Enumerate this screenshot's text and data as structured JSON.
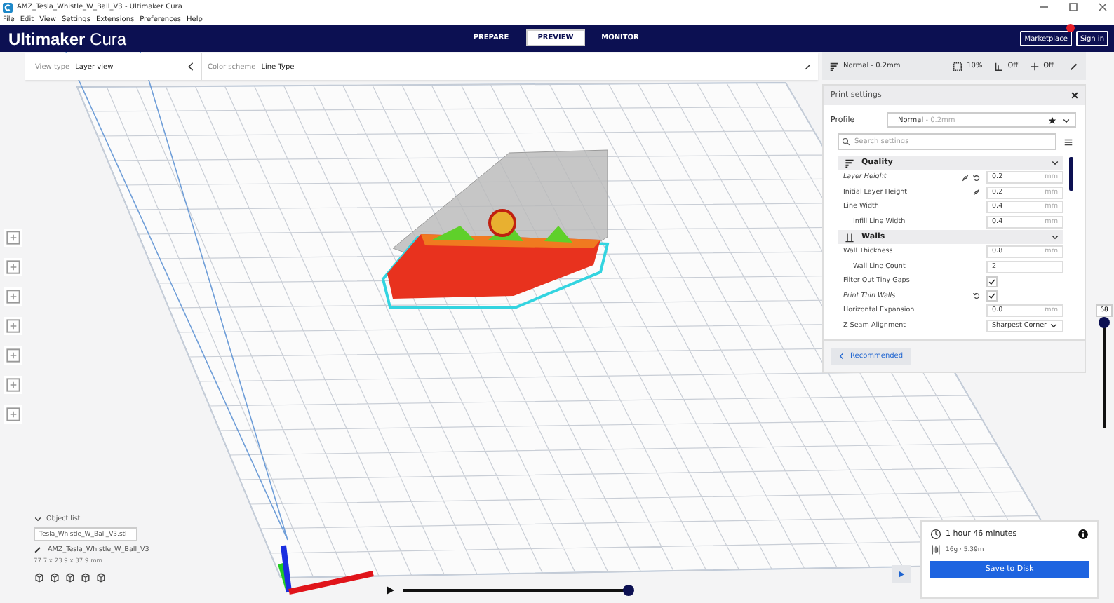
{
  "window": {
    "title": "AMZ_Tesla_Whistle_W_Ball_V3 - Ultimaker Cura"
  },
  "menu": [
    "File",
    "Edit",
    "View",
    "Settings",
    "Extensions",
    "Preferences",
    "Help"
  ],
  "header": {
    "logo_bold": "Ultimaker",
    "logo_light": "Cura",
    "stages": [
      {
        "label": "PREPARE",
        "selected": false
      },
      {
        "label": "PREVIEW",
        "selected": true
      },
      {
        "label": "MONITOR",
        "selected": false
      }
    ],
    "marketplace": "Marketplace",
    "marketplace_notification": true,
    "sign_in": "Sign in"
  },
  "view_bar": {
    "view_type_label": "View type",
    "view_type": "Layer view",
    "color_scheme_label": "Color scheme",
    "color_scheme": "Line Type"
  },
  "print_setup": {
    "profile": "Normal - 0.2mm",
    "infill": "10%",
    "support": "Off",
    "adhesion": "Off"
  },
  "print_settings": {
    "title": "Print settings",
    "profile_label": "Profile",
    "profile_name": "Normal",
    "profile_detail": "- 0.2mm",
    "search_placeholder": "Search settings",
    "categories": [
      {
        "name": "Quality",
        "expanded": true,
        "settings": [
          {
            "label": "Layer Height",
            "kind": "input",
            "value": "0.2",
            "unit": "mm",
            "changed": true,
            "linked": true,
            "resettable": true
          },
          {
            "label": "Initial Layer Height",
            "kind": "input",
            "value": "0.2",
            "unit": "mm",
            "changed": false,
            "linked": true,
            "resettable": false
          },
          {
            "label": "Line Width",
            "kind": "input",
            "value": "0.4",
            "unit": "mm",
            "changed": false,
            "linked": false,
            "resettable": false,
            "children": [
              {
                "label": "Infill Line Width",
                "kind": "input",
                "value": "0.4",
                "unit": "mm",
                "changed": false,
                "linked": false,
                "resettable": false
              }
            ]
          }
        ]
      },
      {
        "name": "Walls",
        "expanded": true,
        "settings": [
          {
            "label": "Wall Thickness",
            "kind": "input",
            "value": "0.8",
            "unit": "mm",
            "changed": false,
            "linked": false,
            "resettable": false,
            "children": [
              {
                "label": "Wall Line Count",
                "kind": "input",
                "value": "2",
                "changed": false,
                "linked": false,
                "resettable": false
              }
            ]
          },
          {
            "label": "Filter Out Tiny Gaps",
            "kind": "checkbox",
            "checked": true,
            "changed": false,
            "linked": false,
            "resettable": false
          },
          {
            "label": "Print Thin Walls",
            "kind": "checkbox",
            "checked": true,
            "changed": true,
            "linked": false,
            "resettable": true
          },
          {
            "label": "Horizontal Expansion",
            "kind": "input",
            "value": "0.0",
            "unit": "mm",
            "changed": false,
            "linked": false,
            "resettable": false
          },
          {
            "label": "Z Seam Alignment",
            "kind": "select",
            "value": "Sharpest Corner",
            "changed": false,
            "linked": false,
            "resettable": false
          }
        ]
      }
    ],
    "recommended_button": "Recommended"
  },
  "layer_slider": {
    "label": "68",
    "level": 1
  },
  "object_list": {
    "title": "Object list",
    "expanded": true,
    "file": "Tesla_Whistle_W_Ball_V3.stl",
    "object_name": "AMZ_Tesla_Whistle_W_Ball_V3",
    "dimensions": "77.7 x 23.9 x 37.9 mm"
  },
  "playback": {
    "level": 1
  },
  "estimate": {
    "time": "1 hour 46 minutes",
    "material": "16g · 5.39m",
    "save_button": "Save to Disk"
  }
}
